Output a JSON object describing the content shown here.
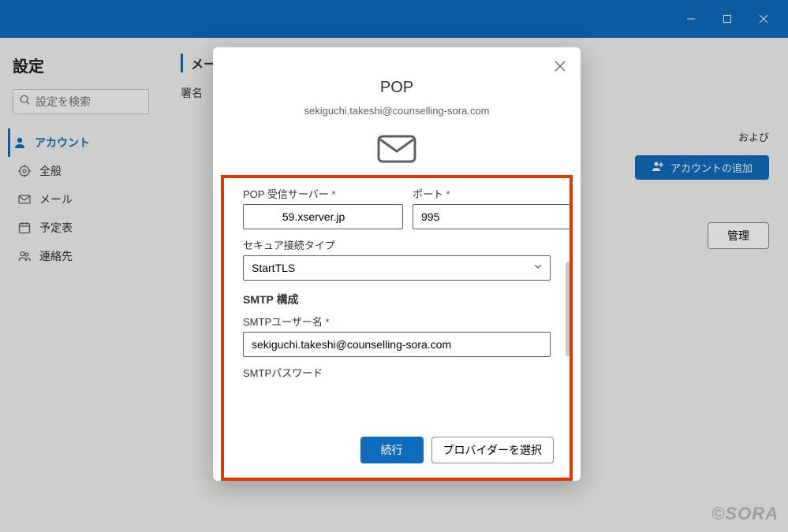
{
  "titlebar": {
    "minimize": "—",
    "maximize": "▢",
    "close": "✕"
  },
  "left": {
    "title": "設定",
    "search_placeholder": "設定を検索",
    "nav": {
      "account": "アカウント",
      "general": "全般",
      "mail": "メール",
      "calendar": "予定表",
      "contacts": "連絡先"
    }
  },
  "main": {
    "section": "メール",
    "sub": "署名",
    "bg_text": "および",
    "add_account": "アカウントの追加",
    "manage": "管理"
  },
  "dialog": {
    "title": "POP",
    "email": "sekiguchi.takeshi@counselling-sora.com",
    "pop_server_label": "POP 受信サーバー",
    "pop_server_value": "          59.xserver.jp",
    "port_label": "ポート",
    "port_value": "995",
    "secure_label": "セキュア接続タイプ",
    "secure_value": "StartTLS",
    "smtp_heading": "SMTP 構成",
    "smtp_user_label": "SMTPユーザー名",
    "smtp_user_value": "sekiguchi.takeshi@counselling-sora.com",
    "smtp_pass_label": "SMTPパスワード",
    "smtp_pass_value": "",
    "continue": "続行",
    "select_provider": "プロバイダーを選択"
  },
  "watermark": "©SORA"
}
